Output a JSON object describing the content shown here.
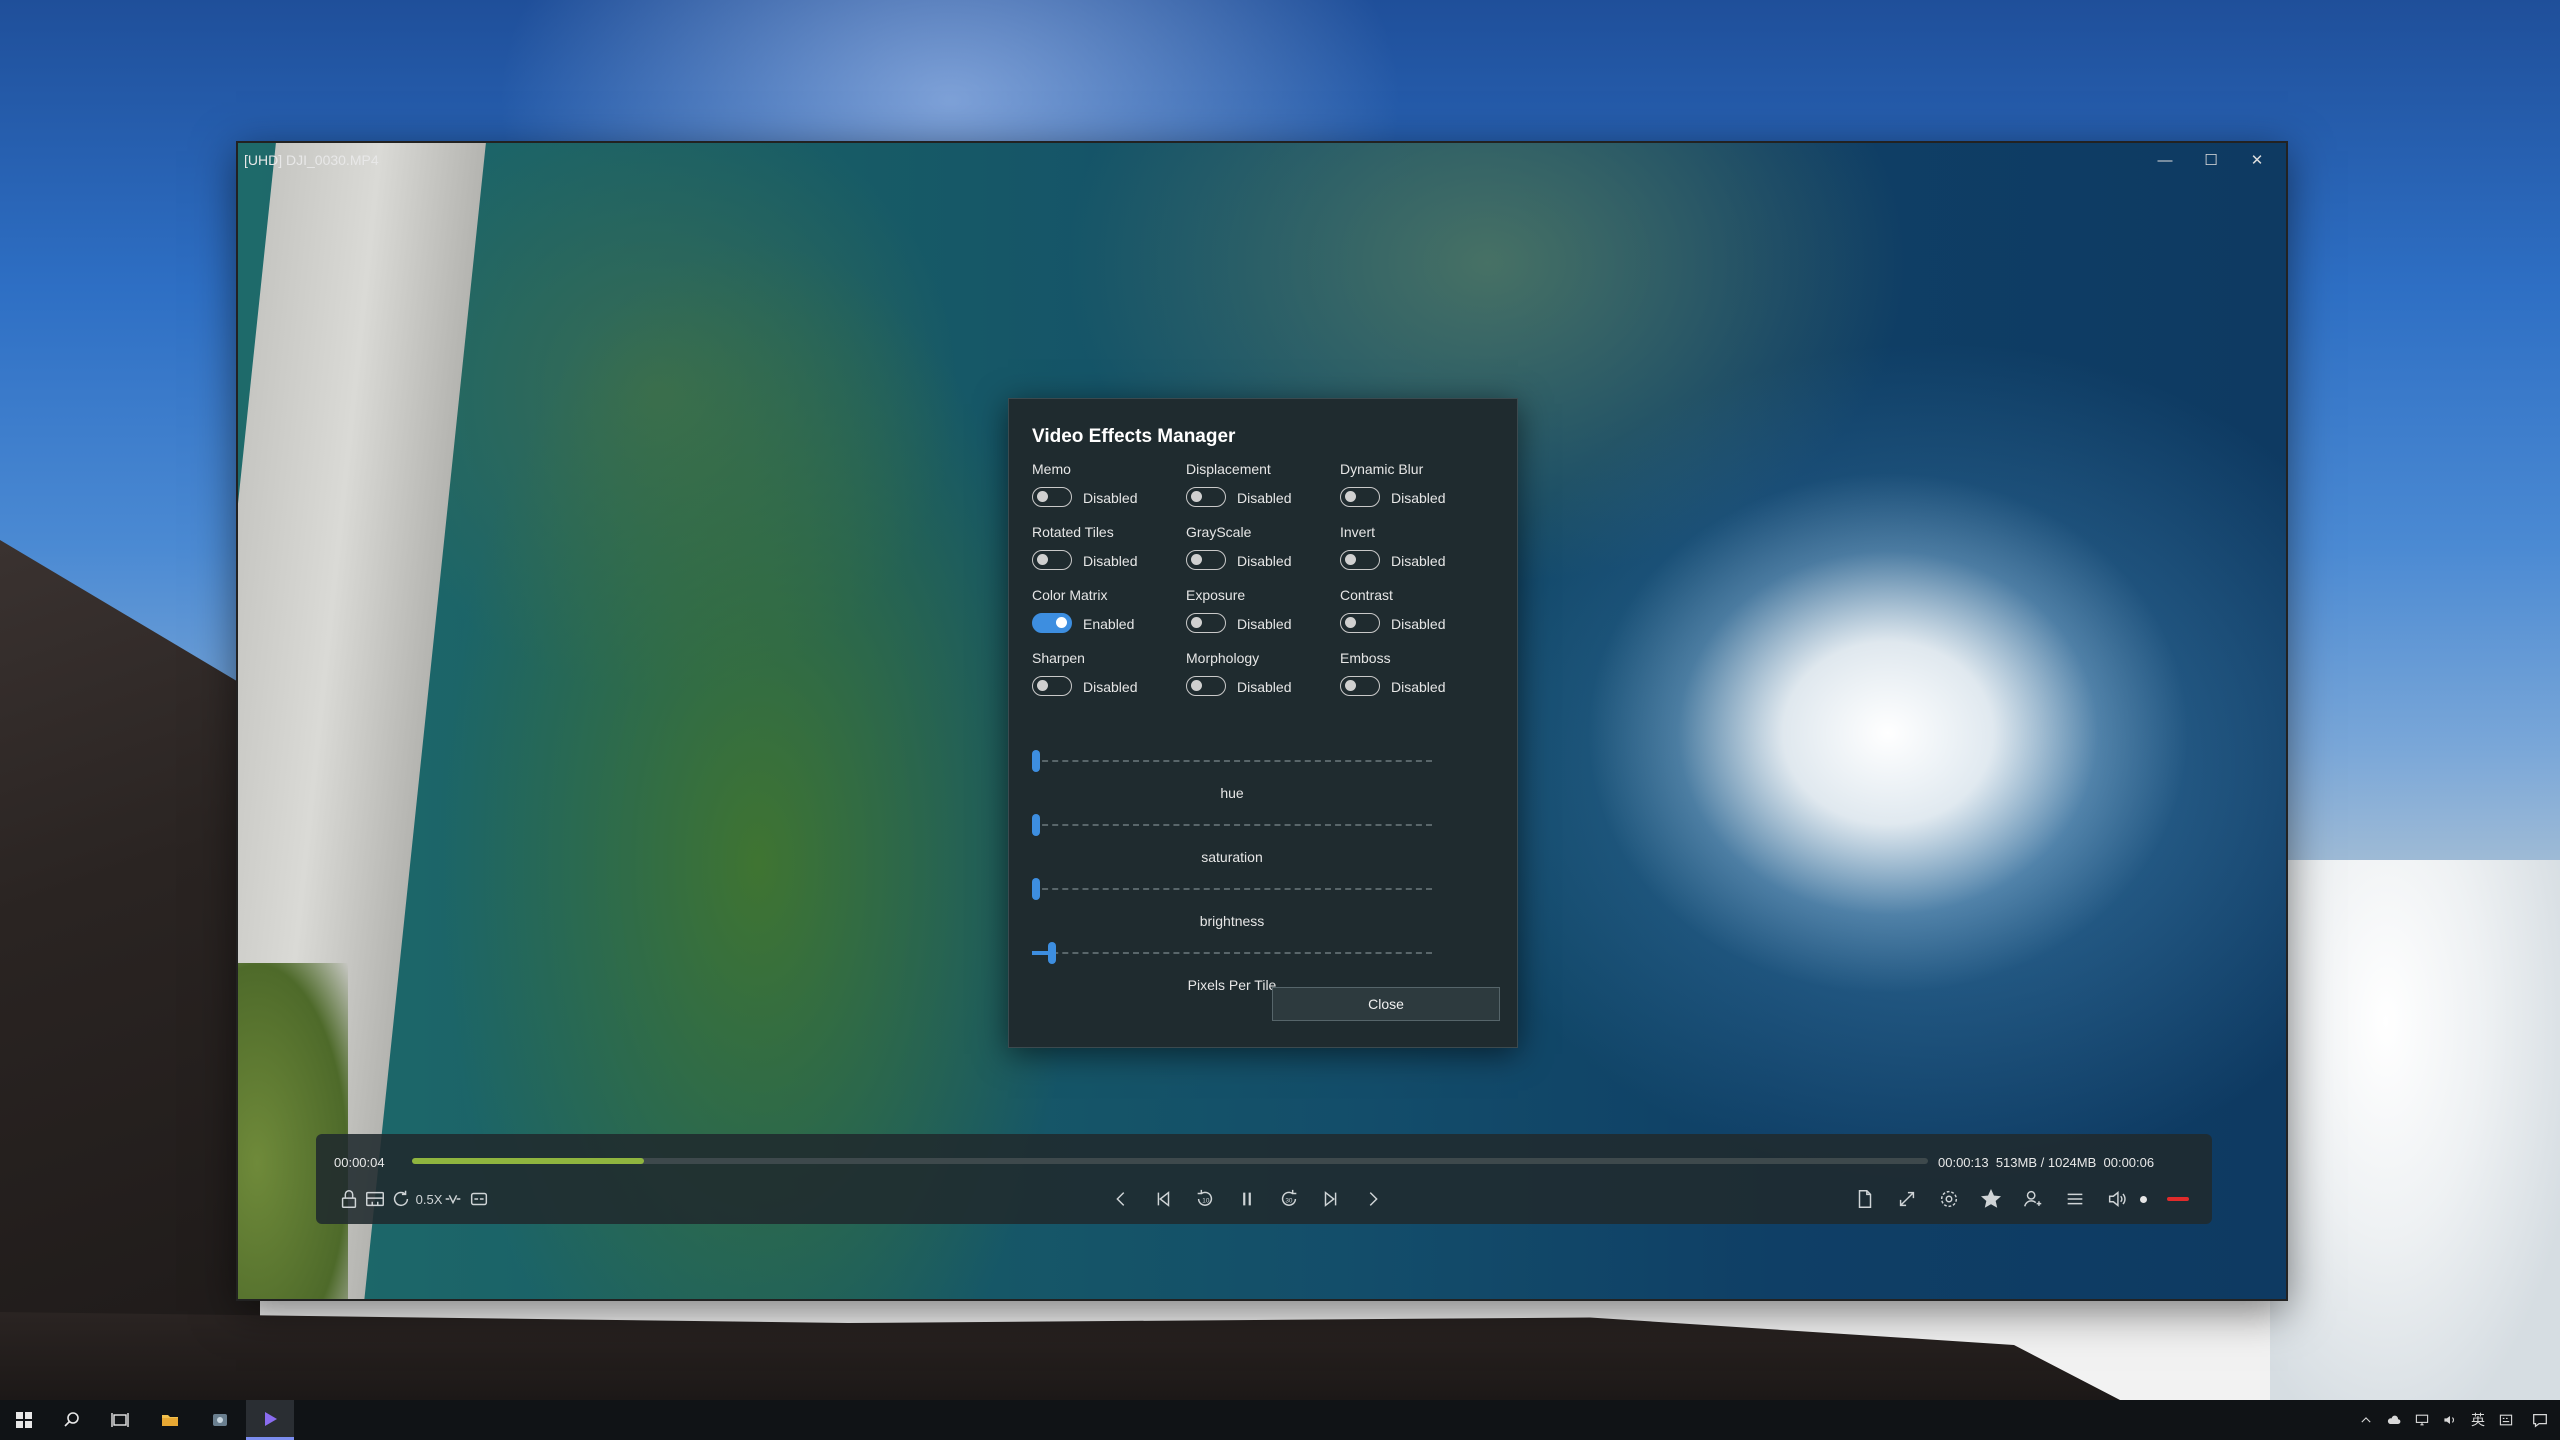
{
  "window": {
    "title": "[UHD] DJI_0030.MP4",
    "minimize_glyph": "—",
    "maximize_glyph": "☐",
    "close_glyph": "✕"
  },
  "dialog": {
    "title": "Video Effects Manager",
    "effects": [
      {
        "label": "Memo",
        "state": "Disabled",
        "on": false
      },
      {
        "label": "Displacement",
        "state": "Disabled",
        "on": false
      },
      {
        "label": "Dynamic Blur",
        "state": "Disabled",
        "on": false
      },
      {
        "label": "Rotated Tiles",
        "state": "Disabled",
        "on": false
      },
      {
        "label": "GrayScale",
        "state": "Disabled",
        "on": false
      },
      {
        "label": "Invert",
        "state": "Disabled",
        "on": false
      },
      {
        "label": "Color Matrix",
        "state": "Enabled",
        "on": true
      },
      {
        "label": "Exposure",
        "state": "Disabled",
        "on": false
      },
      {
        "label": "Contrast",
        "state": "Disabled",
        "on": false
      },
      {
        "label": "Sharpen",
        "state": "Disabled",
        "on": false
      },
      {
        "label": "Morphology",
        "state": "Disabled",
        "on": false
      },
      {
        "label": "Emboss",
        "state": "Disabled",
        "on": false
      }
    ],
    "sliders": [
      {
        "label": "hue",
        "value": 0.0
      },
      {
        "label": "saturation",
        "value": 0.0
      },
      {
        "label": "brightness",
        "value": 0.0
      },
      {
        "label": "Pixels Per Tile",
        "value": 0.04
      }
    ],
    "close_label": "Close"
  },
  "player": {
    "elapsed": "00:00:04",
    "remaining_info": "00:00:13  513MB / 1024MB  00:00:06",
    "progress": 0.153,
    "speed": "0.5X"
  },
  "colors": {
    "accent": "#3d8ee0",
    "progress": "#8fb53f",
    "record": "#e02b2b"
  },
  "tray": {
    "ime": "英"
  }
}
